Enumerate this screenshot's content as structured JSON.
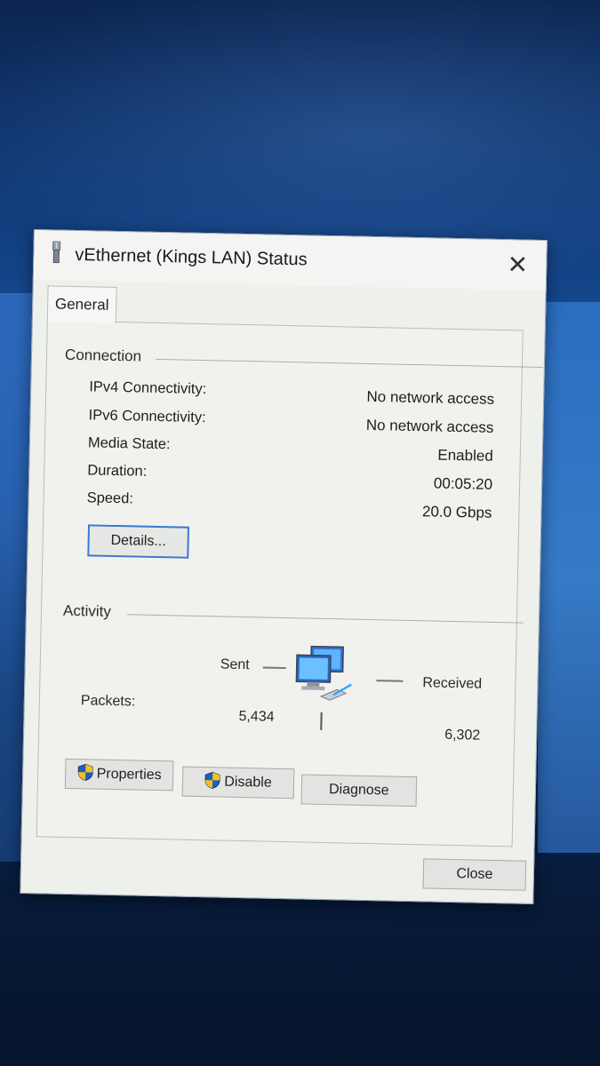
{
  "window": {
    "title": "vEthernet (Kings LAN) Status",
    "close_glyph": "✕"
  },
  "tabs": [
    {
      "label": "General",
      "selected": true
    }
  ],
  "connection": {
    "group_label": "Connection",
    "rows": [
      {
        "label": "IPv4 Connectivity:",
        "value": "No network access"
      },
      {
        "label": "IPv6 Connectivity:",
        "value": "No network access"
      },
      {
        "label": "Media State:",
        "value": "Enabled"
      },
      {
        "label": "Duration:",
        "value": "00:05:20"
      },
      {
        "label": "Speed:",
        "value": "20.0 Gbps"
      }
    ],
    "details_button": "Details..."
  },
  "activity": {
    "group_label": "Activity",
    "sent_label": "Sent",
    "received_label": "Received",
    "packets_label": "Packets:",
    "packets_sent": "5,434",
    "packets_received": "6,302"
  },
  "actions": {
    "properties": "Properties",
    "disable": "Disable",
    "diagnose": "Diagnose"
  },
  "footer": {
    "close": "Close"
  },
  "icons": {
    "title": "network-adapter-icon",
    "shield": "uac-shield-icon",
    "activity": "network-computers-icon"
  },
  "colors": {
    "accent": "#3a7bd0",
    "dialog_bg": "#eef0ec"
  }
}
